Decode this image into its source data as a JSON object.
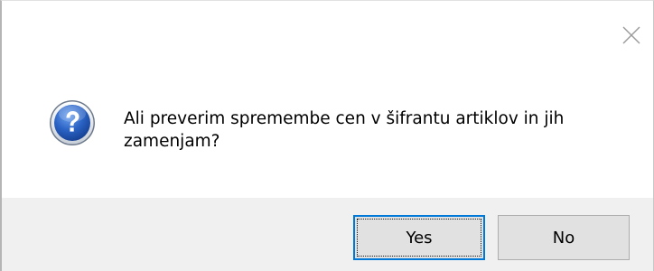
{
  "dialog": {
    "message": "Ali preverim spremembe cen v šifrantu artiklov in jih zamenjam?",
    "icon": "question-icon",
    "close_icon": "close-icon"
  },
  "buttons": {
    "yes_label": "Yes",
    "no_label": "No"
  },
  "colors": {
    "content_bg": "#ffffff",
    "footer_bg": "#f0f0f0",
    "button_bg": "#e1e1e1",
    "default_button_border": "#0078d7",
    "icon_blue": "#1f56b8"
  }
}
